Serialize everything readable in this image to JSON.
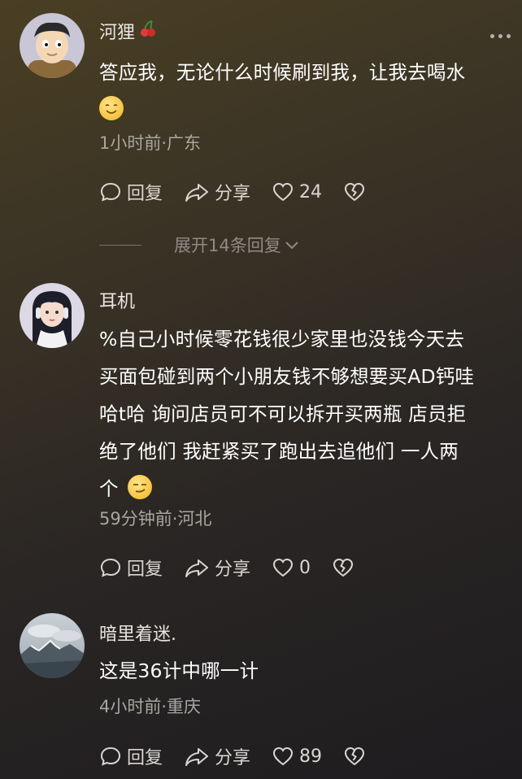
{
  "comments": [
    {
      "username": "河狸",
      "text": "答应我，无论什么时候刷到我，让我去喝水",
      "meta": "1小时前·广东",
      "reply": "回复",
      "share": "分享",
      "likes": "24",
      "expand": "展开14条回复"
    },
    {
      "username": "耳机",
      "text_lines": [
        "%自己小时候零花钱很少家里也没钱今天去",
        "买面包碰到两个小朋友钱不够想要买AD钙哇",
        "哈t哈 询问店员可不可以拆开买两瓶 店员拒",
        "绝了他们 我赶紧买了跑出去追他们 一人两",
        "个"
      ],
      "meta": "59分钟前·河北",
      "reply": "回复",
      "share": "分享",
      "likes": "0"
    },
    {
      "username": "暗里着迷.",
      "text": "这是36计中哪一计",
      "meta": "4小时前·重庆",
      "reply": "回复",
      "share": "分享",
      "likes": "89"
    }
  ],
  "icons": {
    "reply": "chat-bubble-icon",
    "share": "share-arrow-icon",
    "like": "heart-icon",
    "dislike": "broken-heart-icon",
    "more": "more-dots-icon",
    "expand": "chevron-down-icon",
    "badge": "cherry-icon"
  }
}
